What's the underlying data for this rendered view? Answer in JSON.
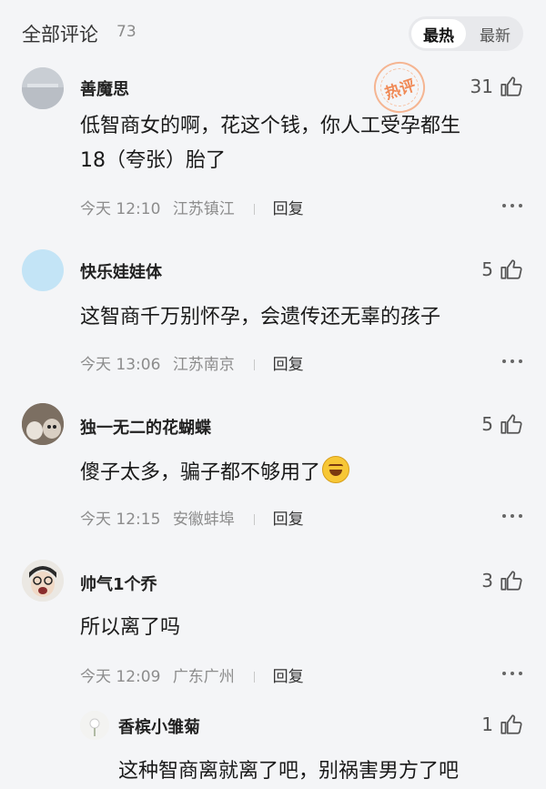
{
  "header": {
    "title": "全部评论",
    "count": "73",
    "sort_hot": "最热",
    "sort_new": "最新"
  },
  "hot_stamp": "热评",
  "comments": [
    {
      "user": "善魔思",
      "likes": "31",
      "text_lines": [
        "低智商女的啊，花这个钱，你人工受孕都生",
        "18（夸张）胎了"
      ],
      "time": "今天 12:10",
      "location": "江苏镇江",
      "reply": "回复"
    },
    {
      "user": "快乐娃娃体",
      "likes": "5",
      "text_lines": [
        "这智商千万别怀孕，会遗传还无辜的孩子"
      ],
      "time": "今天 13:06",
      "location": "江苏南京",
      "reply": "回复"
    },
    {
      "user": "独一无二的花蝴蝶",
      "likes": "5",
      "text_lines": [
        "傻子太多，骗子都不够用了"
      ],
      "time": "今天 12:15",
      "location": "安徽蚌埠",
      "reply": "回复"
    },
    {
      "user": "帅气1个乔",
      "likes": "3",
      "text_lines": [
        "所以离了吗"
      ],
      "time": "今天 12:09",
      "location": "广东广州",
      "reply": "回复"
    }
  ],
  "sub_reply": {
    "user": "香槟小雏菊",
    "likes": "1",
    "text": "这种智商离就离了吧，别祸害男方了吧"
  },
  "icons": {
    "like": "thumbs-up-icon",
    "more": "more-dots-icon",
    "emoji": "grin-emoji-icon"
  }
}
